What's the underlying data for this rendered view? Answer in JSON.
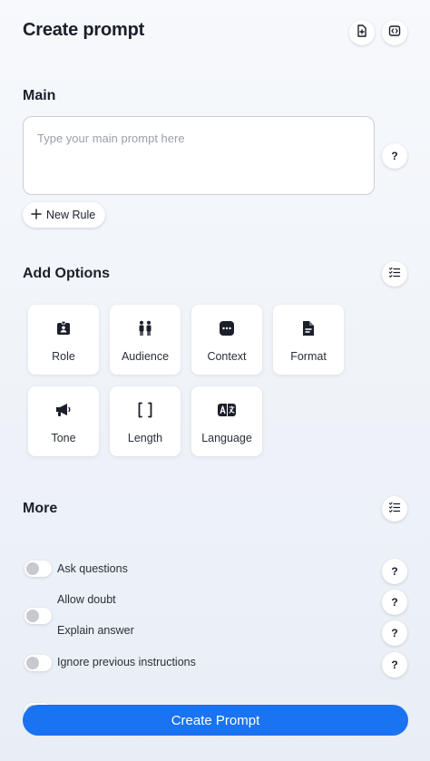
{
  "header": {
    "title": "Create prompt",
    "icons": [
      "file-import-icon",
      "code-icon"
    ]
  },
  "main": {
    "section_title": "Main",
    "prompt_placeholder": "Type your main prompt here",
    "prompt_value": "",
    "new_rule_label": "New Rule"
  },
  "options": {
    "section_title": "Add Options",
    "items": [
      {
        "label": "Role",
        "icon": "id-badge-icon"
      },
      {
        "label": "Audience",
        "icon": "people-icon"
      },
      {
        "label": "Context",
        "icon": "chat-dots-icon"
      },
      {
        "label": "Format",
        "icon": "document-icon"
      },
      {
        "label": "Tone",
        "icon": "megaphone-icon"
      },
      {
        "label": "Length",
        "icon": "brackets-icon"
      },
      {
        "label": "Language",
        "icon": "translate-icon"
      }
    ]
  },
  "more": {
    "section_title": "More",
    "toggles": [
      {
        "label": "Ask questions",
        "on": false
      },
      {
        "label": "Allow doubt",
        "on": false
      },
      {
        "label": "Explain answer",
        "on": false
      },
      {
        "label": "Ignore previous instructions",
        "on": false
      }
    ]
  },
  "help_glyph": "?",
  "footer": {
    "create_label": "Create Prompt"
  },
  "colors": {
    "accent": "#1a73f0",
    "toggle_off": "#c7c9ce"
  }
}
